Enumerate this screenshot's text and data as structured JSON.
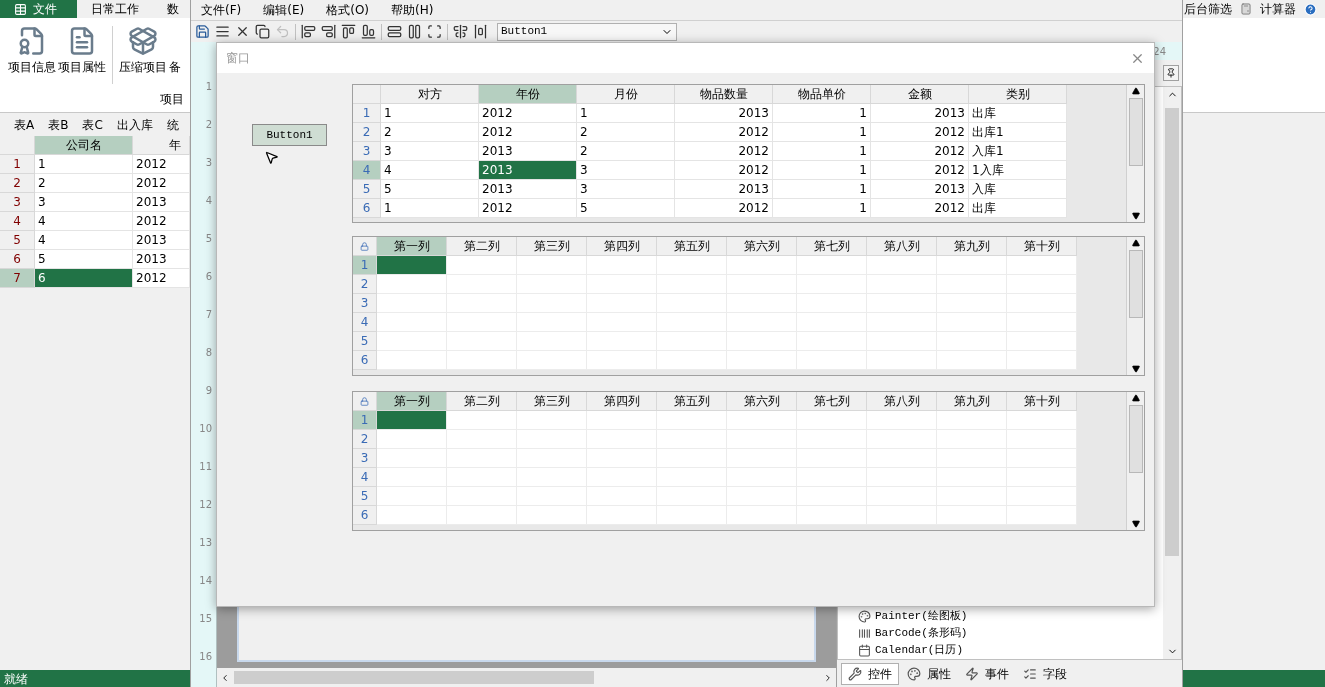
{
  "app": {
    "ribbon_tabs": [
      {
        "label": "文件",
        "selected": true
      },
      {
        "label": "日常工作",
        "selected": false
      },
      {
        "label": "数",
        "selected": false
      }
    ],
    "quick_links": [
      "后台筛选",
      "计算器"
    ],
    "ribbon_buttons": [
      "项目信息",
      "项目属性",
      "压缩项目",
      "备"
    ],
    "ribbon_group": "项目",
    "sheet_tabs": [
      "表A",
      "表B",
      "表C",
      "出入库",
      "统"
    ],
    "sheet": {
      "columns": [
        {
          "label": "公司名",
          "selected": true
        },
        {
          "label": "年",
          "selected": false
        }
      ],
      "rows": [
        {
          "number": "1",
          "cells": [
            "1",
            "2012"
          ],
          "selected": false
        },
        {
          "number": "2",
          "cells": [
            "2",
            "2012"
          ],
          "selected": false
        },
        {
          "number": "3",
          "cells": [
            "3",
            "2013"
          ],
          "selected": false
        },
        {
          "number": "4",
          "cells": [
            "4",
            "2012"
          ],
          "selected": false
        },
        {
          "number": "5",
          "cells": [
            "4",
            "2013"
          ],
          "selected": false
        },
        {
          "number": "6",
          "cells": [
            "5",
            "2013"
          ],
          "selected": false
        },
        {
          "number": "7",
          "cells": [
            "6",
            "2012"
          ],
          "selected": true
        }
      ]
    },
    "status": "就绪"
  },
  "designer": {
    "menu": [
      "文件(F)",
      "编辑(E)",
      "格式(O)",
      "帮助(H)"
    ],
    "component_select": "Button1",
    "ruler_numbers": [
      "1",
      "2",
      "3",
      "4",
      "5",
      "6",
      "7",
      "8",
      "9",
      "10",
      "11",
      "12",
      "13",
      "14",
      "15",
      "16"
    ],
    "top_ruler_number": "24",
    "toolbox_items": [
      "Painter(绘图板)",
      "BarCode(条形码)",
      "Calendar(日历)"
    ],
    "panel_tabs": [
      {
        "label": "控件",
        "selected": true
      },
      {
        "label": "属性",
        "selected": false
      },
      {
        "label": "事件",
        "selected": false
      },
      {
        "label": "字段",
        "selected": false
      }
    ]
  },
  "dialog": {
    "title": "窗口",
    "button": "Button1",
    "grid": {
      "columns": [
        {
          "label": "对方",
          "kind": "text",
          "selected": false
        },
        {
          "label": "年份",
          "kind": "text",
          "selected": true
        },
        {
          "label": "月份",
          "kind": "text",
          "selected": false
        },
        {
          "label": "物品数量",
          "kind": "number",
          "selected": false
        },
        {
          "label": "物品单价",
          "kind": "number",
          "selected": false
        },
        {
          "label": "金额",
          "kind": "number",
          "selected": false
        },
        {
          "label": "类别",
          "kind": "text",
          "selected": false
        }
      ],
      "rows": [
        {
          "number": "1",
          "selected": false,
          "cells": [
            "1",
            "2012",
            "1",
            "2013",
            "1",
            "2013",
            "出库"
          ]
        },
        {
          "number": "2",
          "selected": false,
          "cells": [
            "2",
            "2012",
            "2",
            "2012",
            "1",
            "2012",
            "出库1"
          ]
        },
        {
          "number": "3",
          "selected": false,
          "cells": [
            "3",
            "2013",
            "2",
            "2012",
            "1",
            "2012",
            "入库1"
          ]
        },
        {
          "number": "4",
          "selected": true,
          "cells": [
            "4",
            "2013",
            "3",
            "2012",
            "1",
            "2012",
            "1入库"
          ]
        },
        {
          "number": "5",
          "selected": false,
          "cells": [
            "5",
            "2013",
            "3",
            "2013",
            "1",
            "2013",
            "入库"
          ]
        },
        {
          "number": "6",
          "selected": false,
          "cells": [
            "1",
            "2012",
            "5",
            "2012",
            "1",
            "2012",
            "出库"
          ]
        }
      ]
    },
    "blank_grids": [
      {
        "columns": [
          {
            "label": "第一列",
            "selected": true
          },
          {
            "label": "第二列",
            "selected": false
          },
          {
            "label": "第三列",
            "selected": false
          },
          {
            "label": "第四列",
            "selected": false
          },
          {
            "label": "第五列",
            "selected": false
          },
          {
            "label": "第六列",
            "selected": false
          },
          {
            "label": "第七列",
            "selected": false
          },
          {
            "label": "第八列",
            "selected": false
          },
          {
            "label": "第九列",
            "selected": false
          },
          {
            "label": "第十列",
            "selected": false
          }
        ],
        "rows": [
          {
            "number": "1",
            "selected": true
          },
          {
            "number": "2",
            "selected": false
          },
          {
            "number": "3",
            "selected": false
          },
          {
            "number": "4",
            "selected": false
          },
          {
            "number": "5",
            "selected": false
          },
          {
            "number": "6",
            "selected": false
          }
        ]
      },
      {
        "columns": [
          {
            "label": "第一列",
            "selected": true
          },
          {
            "label": "第二列",
            "selected": false
          },
          {
            "label": "第三列",
            "selected": false
          },
          {
            "label": "第四列",
            "selected": false
          },
          {
            "label": "第五列",
            "selected": false
          },
          {
            "label": "第六列",
            "selected": false
          },
          {
            "label": "第七列",
            "selected": false
          },
          {
            "label": "第八列",
            "selected": false
          },
          {
            "label": "第九列",
            "selected": false
          },
          {
            "label": "第十列",
            "selected": false
          }
        ],
        "rows": [
          {
            "number": "1",
            "selected": true
          },
          {
            "number": "2",
            "selected": false
          },
          {
            "number": "3",
            "selected": false
          },
          {
            "number": "4",
            "selected": false
          },
          {
            "number": "5",
            "selected": false
          },
          {
            "number": "6",
            "selected": false
          }
        ]
      }
    ]
  }
}
